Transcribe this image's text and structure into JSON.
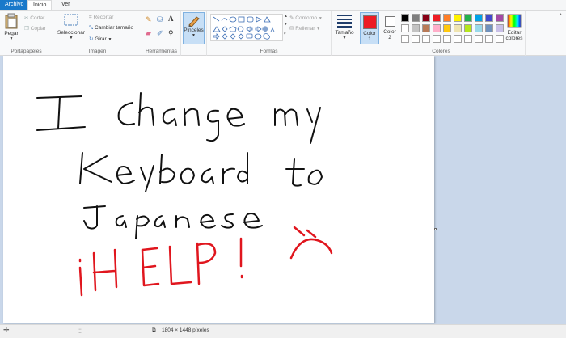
{
  "tabs": [
    {
      "label": "Archivo"
    },
    {
      "label": "Inicio"
    },
    {
      "label": "Ver"
    }
  ],
  "clipboard": {
    "paste": "Pegar",
    "cut": "Cortar",
    "copy": "Copiar",
    "group": "Portapapeles"
  },
  "image": {
    "select": "Seleccionar",
    "crop": "Recortar",
    "resize": "Cambiar tamaño",
    "rotate": "Girar",
    "group": "Imagen"
  },
  "tools": {
    "group": "Herramientas"
  },
  "brushes": {
    "label": "Pinceles"
  },
  "shapes": {
    "outline": "Contorno",
    "fill": "Rellenar",
    "group": "Formas"
  },
  "size": {
    "label": "Tamaño"
  },
  "colors": {
    "color1": "Color",
    "color1_num": "1",
    "color2": "Color",
    "color2_num": "2",
    "edit_line1": "Editar",
    "edit_line2": "colores",
    "group": "Colores",
    "color1_value": "#ed1c24",
    "color2_value": "#ffffff",
    "palette": [
      "#000000",
      "#7f7f7f",
      "#880015",
      "#ed1c24",
      "#ff7f27",
      "#fff200",
      "#22b14c",
      "#00a2e8",
      "#3f48cc",
      "#a349a4",
      "#ffffff",
      "#c3c3c3",
      "#b97a57",
      "#ffaec9",
      "#ffc90e",
      "#efe4b0",
      "#b5e61d",
      "#99d9ea",
      "#7092be",
      "#c8bfe7",
      "#ffffff",
      "#ffffff",
      "#ffffff",
      "#ffffff",
      "#ffffff",
      "#ffffff",
      "#ffffff",
      "#ffffff",
      "#ffffff",
      "#ffffff"
    ]
  },
  "status": {
    "dimensions": "1804 × 1448 píxeles"
  }
}
